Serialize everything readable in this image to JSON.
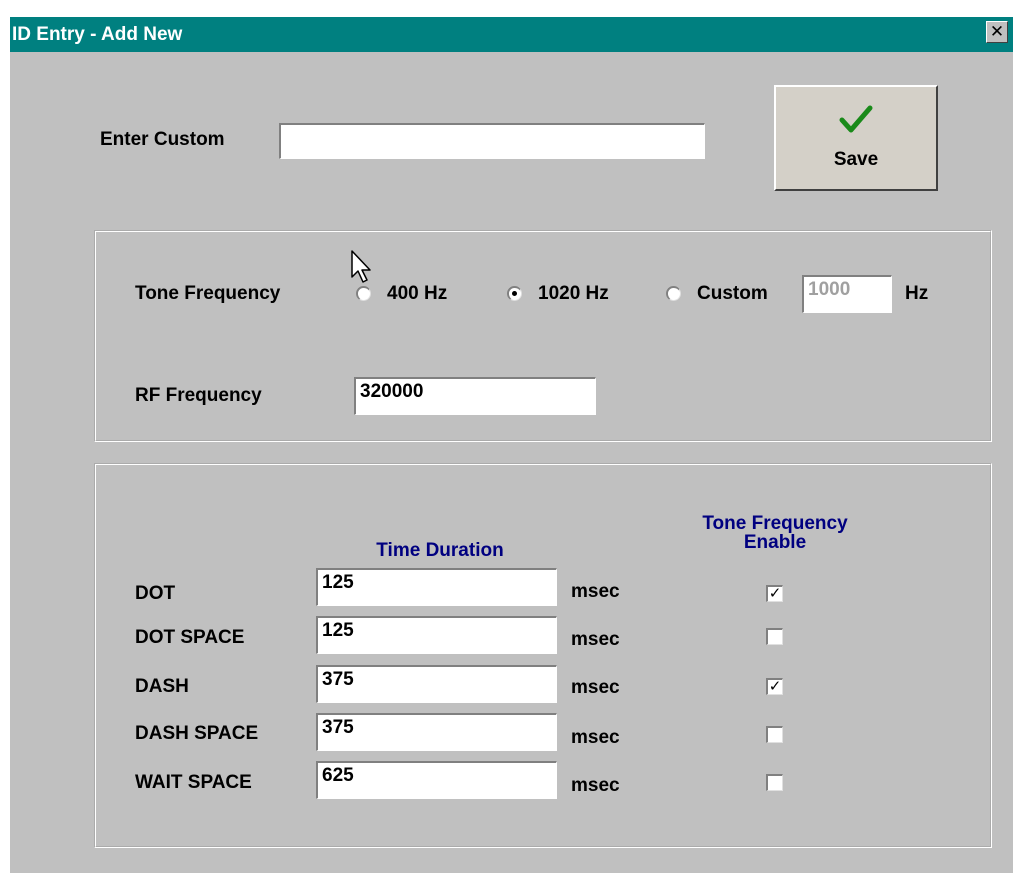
{
  "window": {
    "title": "ID Entry - Add New",
    "close_glyph": "✕"
  },
  "custom": {
    "label": "Enter Custom",
    "value": ""
  },
  "save": {
    "label": "Save",
    "icon": "checkmark-icon"
  },
  "tone": {
    "label": "Tone Frequency",
    "options": [
      {
        "label": "400 Hz",
        "selected": false
      },
      {
        "label": "1020 Hz",
        "selected": true
      },
      {
        "label": "Custom",
        "selected": false
      }
    ],
    "custom_value": "1000",
    "unit": "Hz"
  },
  "rf": {
    "label": "RF Frequency",
    "value": "320000"
  },
  "timing": {
    "col_duration": "Time Duration",
    "col_enable_line1": "Tone Frequency",
    "col_enable_line2": "Enable",
    "unit": "msec",
    "rows": [
      {
        "label": "DOT",
        "value": "125",
        "enabled": true
      },
      {
        "label": "DOT SPACE",
        "value": "125",
        "enabled": false
      },
      {
        "label": "DASH",
        "value": "375",
        "enabled": true
      },
      {
        "label": "DASH SPACE",
        "value": "375",
        "enabled": false
      },
      {
        "label": "WAIT SPACE",
        "value": "625",
        "enabled": false
      }
    ]
  },
  "check_glyph": "✓",
  "colors": {
    "titlebar": "#008080",
    "face": "#c0c0c0",
    "header_text": "#000080",
    "check_icon": "#1a8a1a"
  }
}
